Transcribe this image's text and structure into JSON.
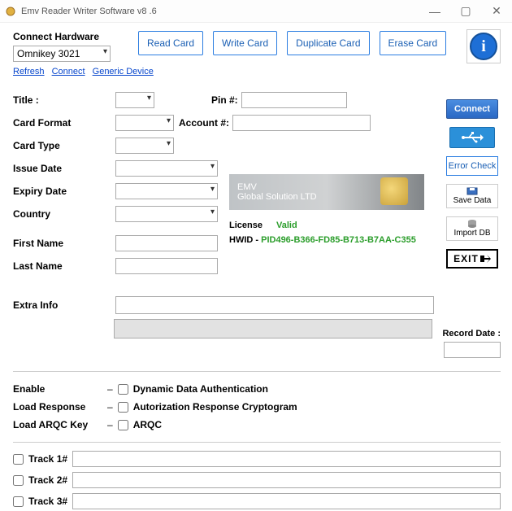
{
  "window": {
    "title": "Emv Reader Writer Software v8 .6"
  },
  "hardware": {
    "heading": "Connect Hardware",
    "device": "Omnikey 3021",
    "links": {
      "refresh": "Refresh",
      "connect": "Connect",
      "generic": "Generic Device"
    }
  },
  "actions": {
    "read": "Read Card",
    "write": "Write Card",
    "duplicate": "Duplicate Card",
    "erase": "Erase Card"
  },
  "side": {
    "connect": "Connect",
    "error_check": "Error Check",
    "save_data": "Save Data",
    "import_db": "Import DB",
    "exit": "EXIT"
  },
  "labels": {
    "title": "Title :",
    "pin": "Pin #:",
    "card_format": "Card Format",
    "account": "Account #:",
    "card_type": "Card Type",
    "issue_date": "Issue Date",
    "expiry_date": "Expiry Date",
    "country": "Country",
    "first_name": "First Name",
    "last_name": "Last Name",
    "extra_info": "Extra Info",
    "record_date": "Record Date :",
    "enable": "Enable",
    "load_response": "Load Response",
    "load_arqc": "Load ARQC Key",
    "track1": "Track 1#",
    "track2": "Track 2#",
    "track3": "Track 3#"
  },
  "options": {
    "dda": "Dynamic Data Authentication",
    "arc": "Autorization Response Cryptogram",
    "arqc": "ARQC"
  },
  "banner": {
    "line1": "EMV",
    "line2": "Global Solution LTD"
  },
  "license": {
    "label": "License",
    "status": "Valid",
    "hwid_label": "HWID -",
    "hwid": "PID496-B366-FD85-B713-B7AA-C355"
  },
  "values": {
    "title": "",
    "pin": "",
    "card_format": "",
    "account": "",
    "card_type": "",
    "issue_date": "",
    "expiry_date": "",
    "country": "",
    "first_name": "",
    "last_name": "",
    "extra_info": "",
    "readonly": "",
    "record_date": "",
    "track1": "",
    "track2": "",
    "track3": ""
  }
}
